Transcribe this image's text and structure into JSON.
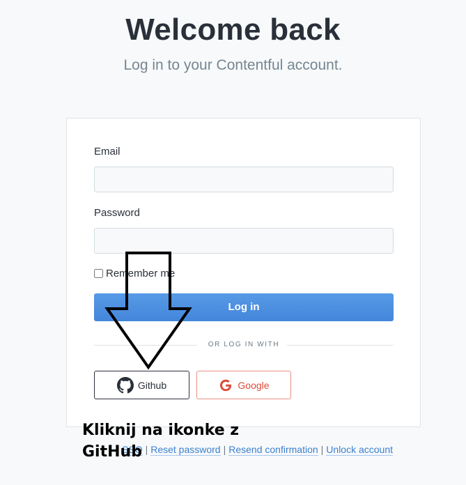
{
  "page": {
    "title": "Welcome back",
    "subtitle": "Log in to your Contentful account."
  },
  "form": {
    "email_label": "Email",
    "email_value": "",
    "password_label": "Password",
    "password_value": "",
    "remember_label": "Remember me",
    "remember_checked": false,
    "login_label": "Log in",
    "divider_text": "OR LOG IN WITH",
    "github_label": "Github",
    "google_label": "Google"
  },
  "footer_links": {
    "sso": "SSO",
    "reset": "Reset password",
    "resend": "Resend confirmation",
    "unlock": "Unlock account",
    "separator": "|"
  },
  "annotation": {
    "line1": "Kliknij na ikonke z",
    "line2": "GitHub"
  },
  "colors": {
    "accent": "#4a90e2",
    "google": "#dd4b39",
    "link": "#3c80cf"
  },
  "icons": {
    "github": "github-icon",
    "google": "google-icon",
    "arrow": "down-arrow-icon"
  }
}
